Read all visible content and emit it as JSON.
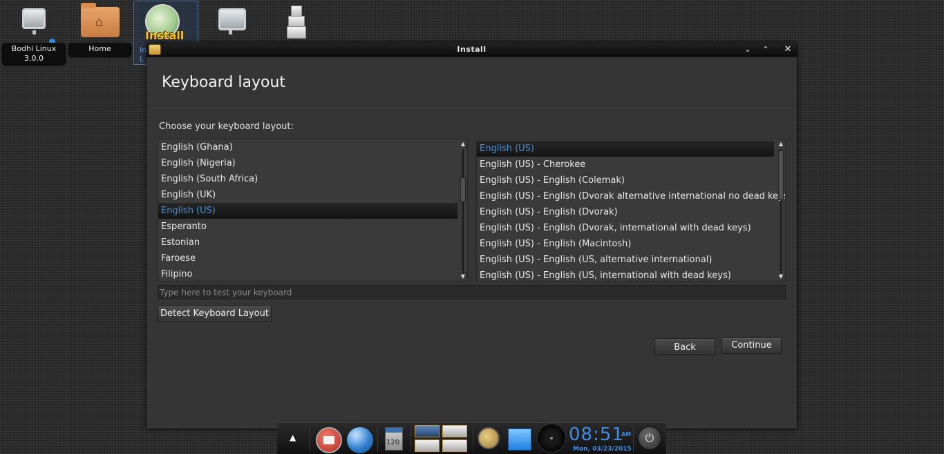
{
  "desktop": {
    "icons": [
      {
        "label": "Bodhi Linux\n3.0.0"
      },
      {
        "label": "Home"
      },
      {
        "label": "Install",
        "sublabel": "In\nL"
      }
    ]
  },
  "window": {
    "title": "Install",
    "controls": {
      "minimize": "⌄",
      "maximize": "⌃",
      "close": "✕"
    },
    "heading": "Keyboard layout",
    "prompt": "Choose your keyboard layout:",
    "layouts": [
      "English (Ghana)",
      "English (Nigeria)",
      "English (South Africa)",
      "English (UK)",
      "English (US)",
      "Esperanto",
      "Estonian",
      "Faroese",
      "Filipino"
    ],
    "selected_layout_index": 4,
    "variants": [
      "English (US)",
      "English (US) - Cherokee",
      "English (US) - English (Colemak)",
      "English (US) - English (Dvorak alternative international no dead keys)",
      "English (US) - English (Dvorak)",
      "English (US) - English (Dvorak, international with dead keys)",
      "English (US) - English (Macintosh)",
      "English (US) - English (US, alternative international)",
      "English (US) - English (US, international with dead keys)"
    ],
    "selected_variant_index": 0,
    "test_placeholder": "Type here to test your keyboard",
    "detect_button": "Detect Keyboard Layout",
    "back_button": "Back",
    "continue_button": "Continue"
  },
  "dock": {
    "calendar_badge": "120",
    "clock_time": "08:51",
    "clock_ampm": "AM",
    "clock_date": "Mon, 03/23/2015",
    "accent_color": "#3e8ee8"
  }
}
